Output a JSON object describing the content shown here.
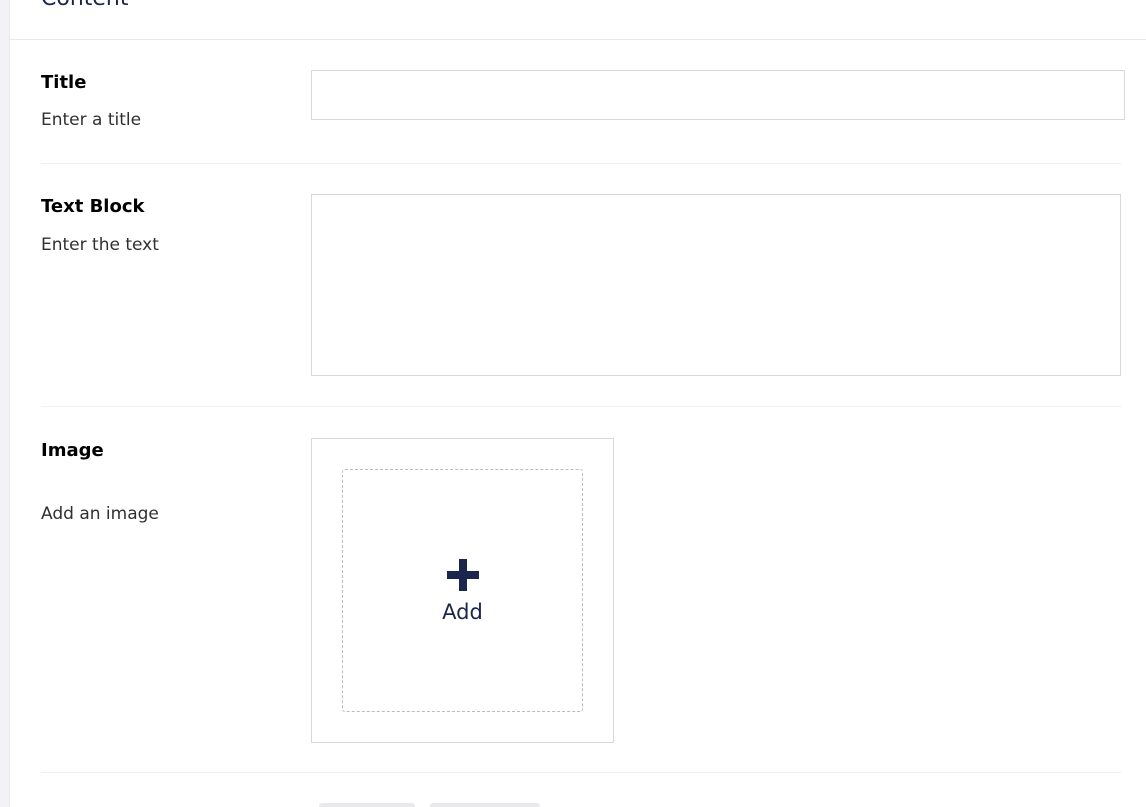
{
  "panel": {
    "title": "Content"
  },
  "properties": {
    "title": {
      "label": "Title",
      "description": "Enter a title",
      "value": ""
    },
    "text_block": {
      "label": "Text Block",
      "description": "Enter the text",
      "value": ""
    },
    "image": {
      "label": "Image",
      "description": "Add an image",
      "add_label": "Add"
    }
  },
  "icons": {
    "add": "plus-icon"
  },
  "colors": {
    "primary": "#1b264f",
    "border": "#d8d7d9",
    "background": "#f3f3f5"
  }
}
